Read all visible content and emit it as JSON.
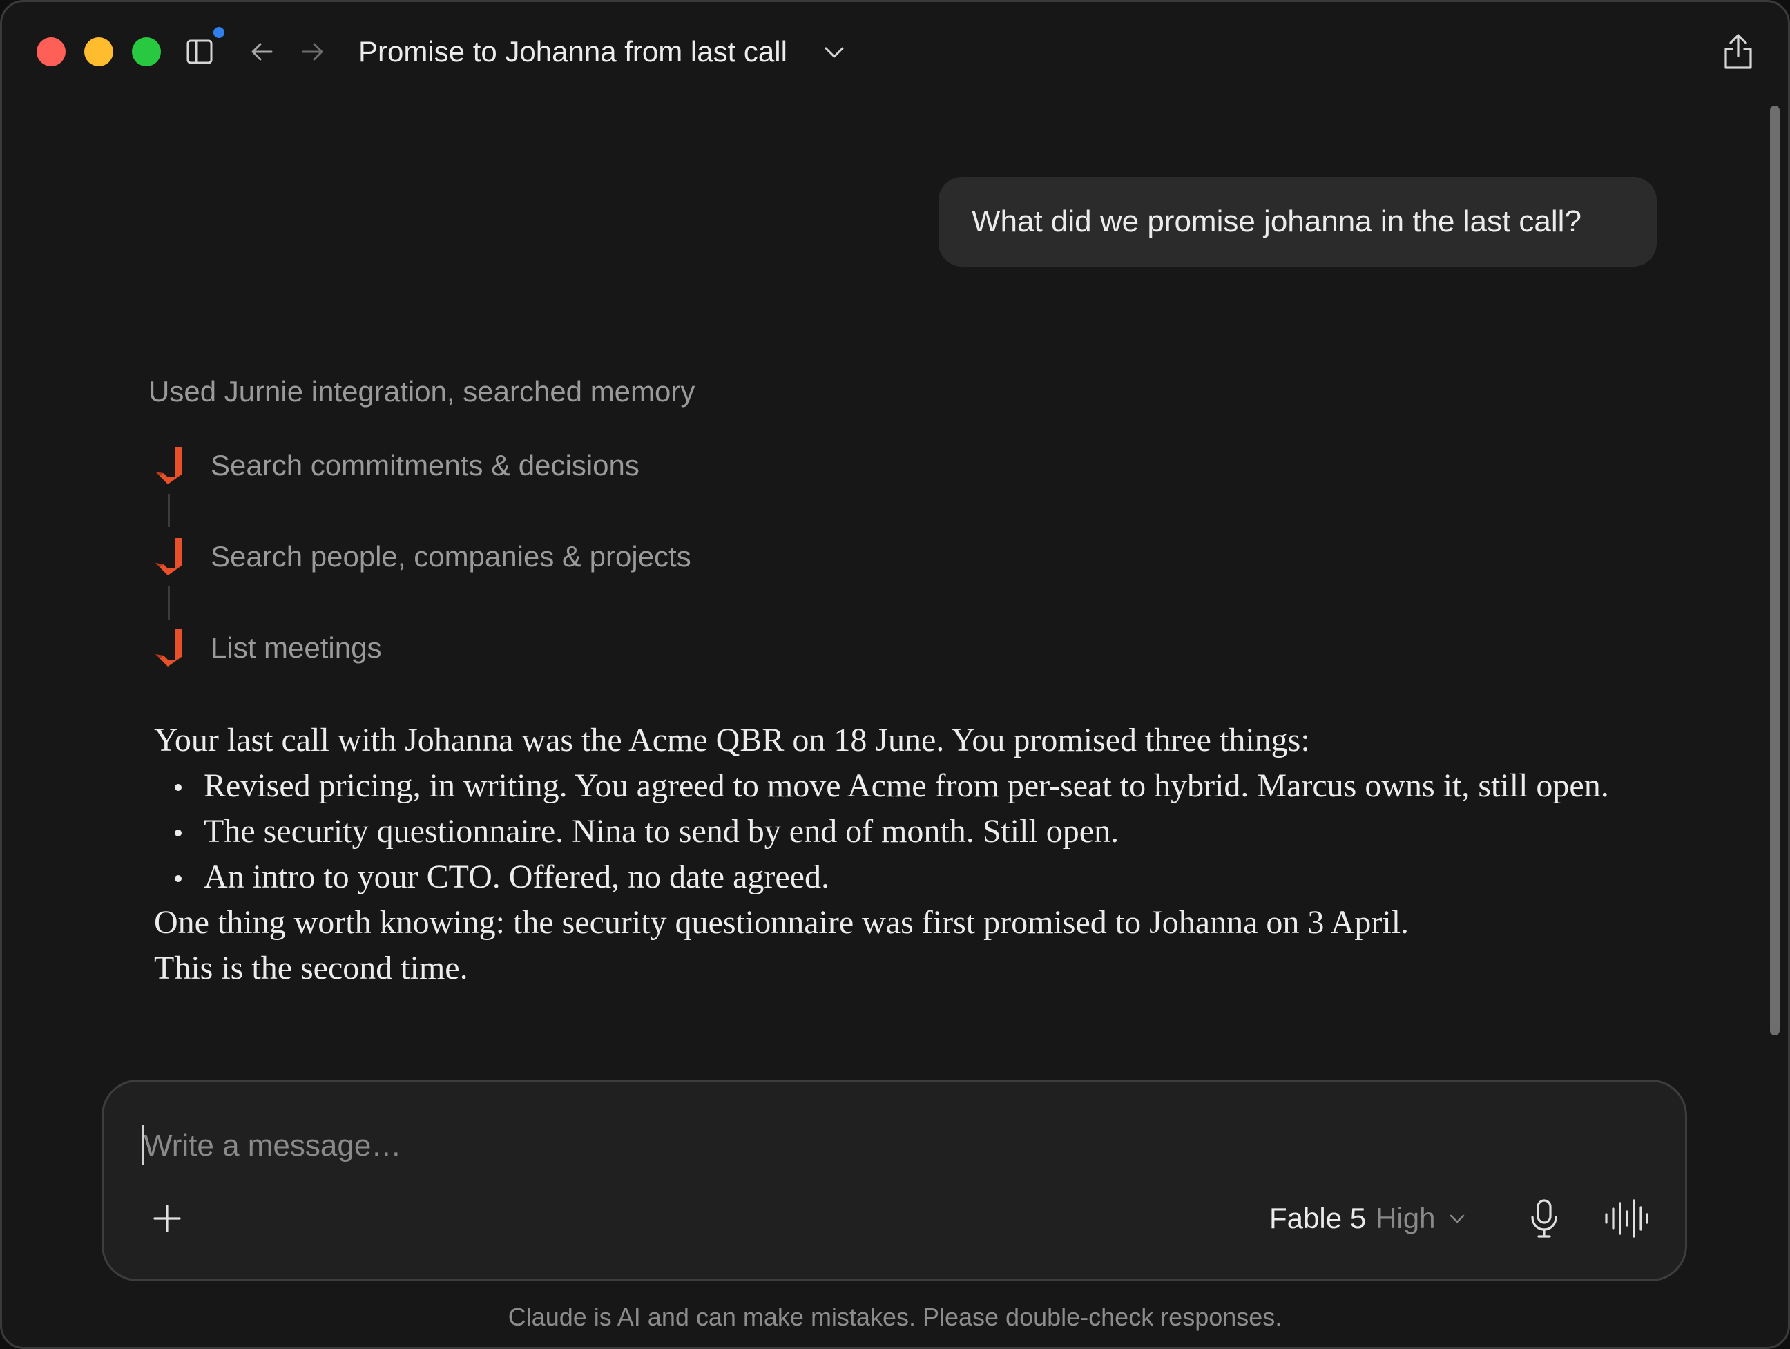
{
  "window": {
    "title": "Promise to Johanna from last call",
    "icons": {
      "close": "close-button",
      "minimize": "minimize-button",
      "zoom": "zoom-button",
      "sidebar": "sidebar-toggle-icon",
      "back": "back-arrow-icon",
      "forward": "forward-arrow-icon",
      "title_menu": "chevron-down-icon",
      "share": "share-icon"
    },
    "colors": {
      "close": "#fe5f57",
      "minimize": "#febc2e",
      "zoom": "#28c840",
      "notification_dot": "#2f80ed"
    }
  },
  "conversation": {
    "user_message": "What did we promise johanna in the last call?",
    "tool_usage": {
      "summary": "Used Jurnie integration, searched memory",
      "steps": [
        {
          "label": "Search commitments & decisions",
          "icon": "jurnie-logo-icon"
        },
        {
          "label": "Search people, companies & projects",
          "icon": "jurnie-logo-icon"
        },
        {
          "label": "List meetings",
          "icon": "jurnie-logo-icon"
        }
      ],
      "accent_color": "#e8502a"
    },
    "response": {
      "intro": "Your last call with Johanna was the Acme QBR on 18 June. You promised three things:",
      "bullets": [
        "Revised pricing, in writing. You agreed to move Acme from per-seat to hybrid. Marcus owns it, still open.",
        "The security questionnaire. Nina to send by end of month. Still open.",
        "An intro to your CTO. Offered, no date agreed."
      ],
      "outro_line1": "One thing worth knowing: the security questionnaire was first promised to Johanna on 3 April.",
      "outro_line2": "This is the second time."
    }
  },
  "composer": {
    "placeholder": "Write a message…",
    "value": "",
    "model_name": "Fable 5",
    "effort": "High",
    "icons": {
      "attach": "plus-icon",
      "model_menu": "chevron-down-icon",
      "dictation": "microphone-icon",
      "voice": "voice-waveform-icon"
    }
  },
  "footer": {
    "disclaimer": "Claude is AI and can make mistakes. Please double-check responses."
  }
}
